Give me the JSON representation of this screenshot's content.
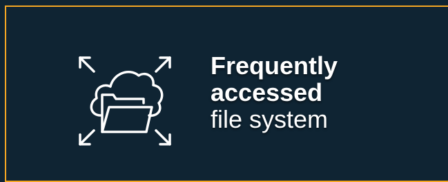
{
  "card": {
    "border_color": "#f5a623",
    "background_color": "#0f2433",
    "icon": "cloud-folder-expand-icon",
    "title_line1": "Frequently",
    "title_line2": "accessed",
    "subtitle": "file system"
  }
}
